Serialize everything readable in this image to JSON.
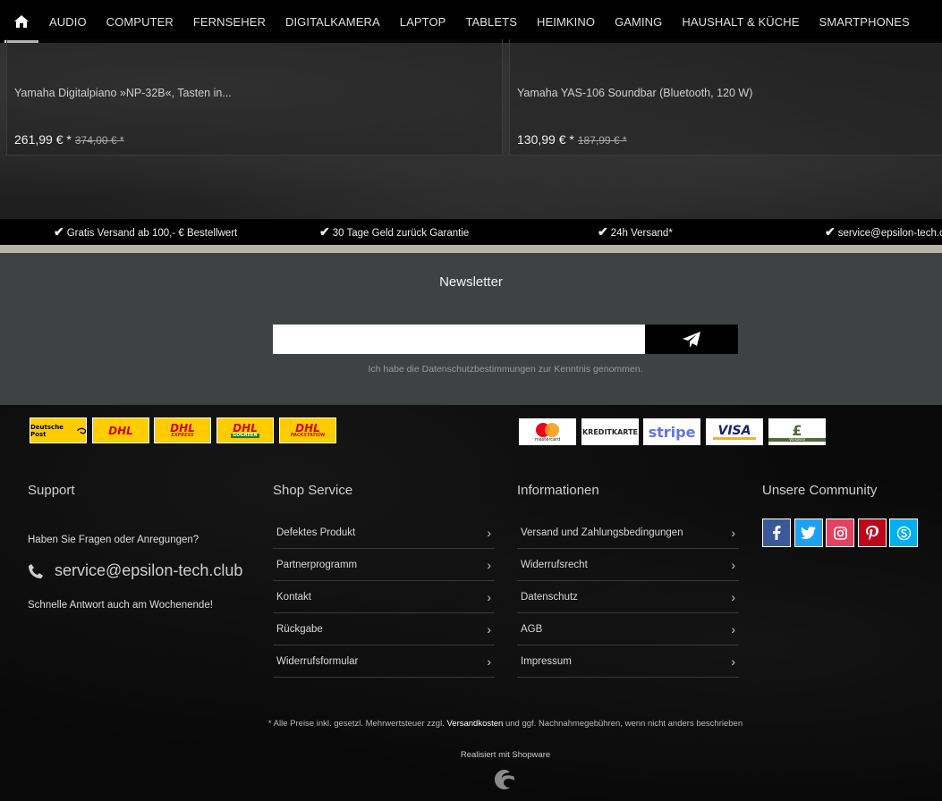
{
  "nav": {
    "items": [
      "Audio",
      "Computer",
      "Fernseher",
      "Digitalkamera",
      "Laptop",
      "Tablets",
      "Heimkino",
      "Gaming",
      "Haushalt & Küche",
      "Smartphones"
    ]
  },
  "products": [
    {
      "name": "Yamaha Digitalpiano »NP-32B«, Tasten in...",
      "price": "261,99 € *",
      "old_price": "374,00 € *"
    },
    {
      "name": "Yamaha YAS-106 Soundbar (Bluetooth, 120 W)",
      "price": "130,99 € *",
      "old_price": "187,99 € *"
    }
  ],
  "usp": [
    {
      "text": "Gratis Versand ab 100,- € Bestellwert"
    },
    {
      "text": "30 Tage Geld zurück Garantie"
    },
    {
      "text": "24h Versand*"
    },
    {
      "text": "service@epsilon-tech.club"
    }
  ],
  "newsletter": {
    "title": "Newsletter",
    "email_value": "",
    "email_placeholder": "",
    "note": "Ich habe die Datenschutzbestimmungen zur Kenntnis genommen."
  },
  "shipping_logos": [
    {
      "label": "Deutsche Post",
      "icon": "post-horn-icon"
    },
    {
      "label": "DHL",
      "icon": "dhl-icon"
    },
    {
      "label": "DHL",
      "sub": "EXPRESS",
      "icon": "dhl-express-icon"
    },
    {
      "label": "DHL",
      "sub": "GOGREEN",
      "icon": "dhl-gogreen-icon"
    },
    {
      "label": "DHL",
      "sub": "PACKSTATION",
      "icon": "dhl-packstation-icon"
    }
  ],
  "payment_logos": [
    {
      "label": "mastercard",
      "icon": "mastercard-icon"
    },
    {
      "label": "KREDITKARTE",
      "icon": "credit-card-icon"
    },
    {
      "label": "stripe",
      "icon": "stripe-icon"
    },
    {
      "label": "VISA",
      "icon": "visa-icon"
    },
    {
      "label": "Vorkasse",
      "icon": "prepayment-icon"
    }
  ],
  "support": {
    "title": "Support",
    "question": "Haben Sie Fragen oder Anregungen?",
    "email": "service@epsilon-tech.club",
    "fast": "Schnelle Antwort auch am Wochenende!"
  },
  "shop_service": {
    "title": "Shop Service",
    "links": [
      "Defektes Produkt",
      "Partnerprogramm",
      "Kontakt",
      "Rückgabe",
      "Widerrufsformular"
    ]
  },
  "informationen": {
    "title": "Informationen",
    "links": [
      "Versand und Zahlungsbedingungen",
      "Widerrufsrecht",
      "Datenschutz",
      "AGB",
      "Impressum"
    ]
  },
  "community": {
    "title": "Unsere Community",
    "icons": [
      {
        "name": "facebook-icon",
        "color": "#3b5998"
      },
      {
        "name": "twitter-icon",
        "color": "#1da1f2"
      },
      {
        "name": "instagram-icon",
        "color": "#e4405f"
      },
      {
        "name": "pinterest-icon",
        "color": "#bd081c"
      },
      {
        "name": "skype-icon",
        "color": "#00aff0"
      }
    ]
  },
  "legal": {
    "prefix": "* Alle Preise inkl. gesetzl. Mehrwertsteuer zzgl.",
    "link": "Versandkosten",
    "suffix": "und ggf. Nachnahmegebühren, wenn nicht anders beschrieben"
  },
  "powered": "Realisiert mit Shopware"
}
